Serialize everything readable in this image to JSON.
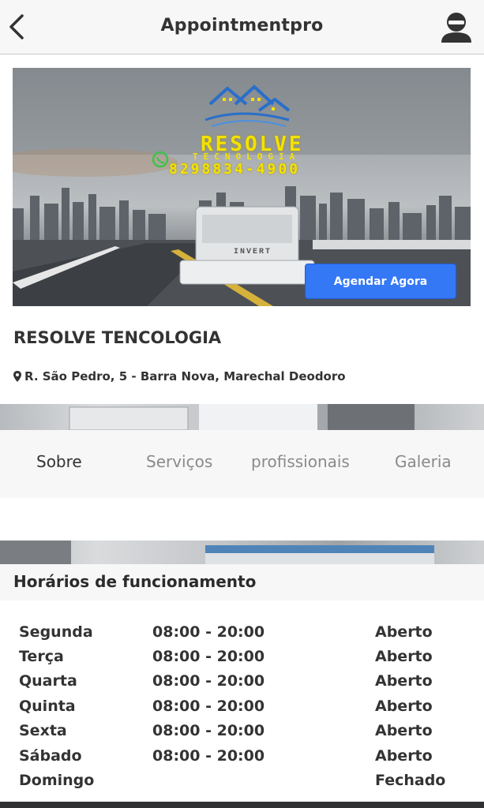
{
  "header": {
    "title": "Appointmentpro",
    "back_icon": "chevron-left-icon",
    "profile_icon": "user-avatar-icon"
  },
  "banner": {
    "brand": "RESOLVE",
    "subtitle": "TECNOLOGIA",
    "phone": "8298834-4900",
    "unit_label": "INVERT",
    "cta_label": "Agendar Agora",
    "cta_color": "#3478f6"
  },
  "business": {
    "name": "RESOLVE TENCOLOGIA",
    "address": "R. São Pedro, 5 - Barra Nova, Marechal Deodoro"
  },
  "tabs": [
    {
      "label": "Sobre",
      "active": true
    },
    {
      "label": "Serviços",
      "active": false
    },
    {
      "label": "profissionais",
      "active": false
    },
    {
      "label": "Galeria",
      "active": false
    }
  ],
  "hours": {
    "title": "Horários de funcionamento",
    "rows": [
      {
        "day": "Segunda",
        "time": "08:00 - 20:00",
        "status": "Aberto"
      },
      {
        "day": "Terça",
        "time": "08:00 - 20:00",
        "status": "Aberto"
      },
      {
        "day": "Quarta",
        "time": "08:00 - 20:00",
        "status": "Aberto"
      },
      {
        "day": "Quinta",
        "time": "08:00 - 20:00",
        "status": "Aberto"
      },
      {
        "day": "Sexta",
        "time": "08:00 - 20:00",
        "status": "Aberto"
      },
      {
        "day": "Sábado",
        "time": "08:00 - 20:00",
        "status": "Aberto"
      },
      {
        "day": "Domingo",
        "time": "",
        "status": "Fechado"
      }
    ]
  }
}
